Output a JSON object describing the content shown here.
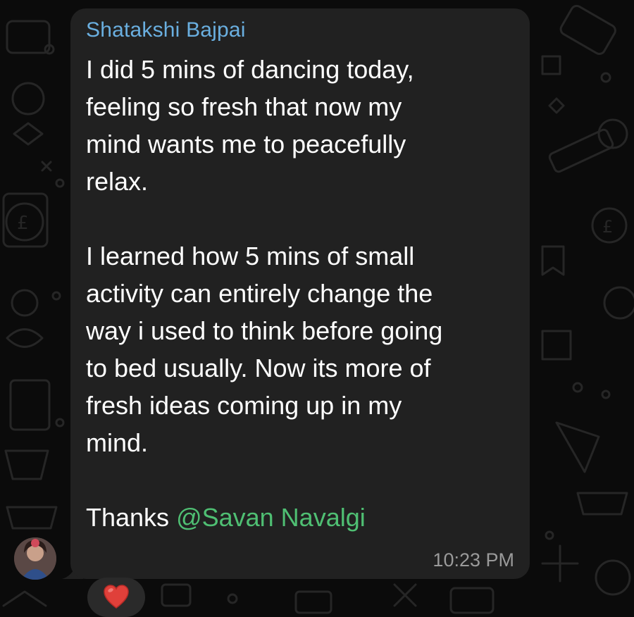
{
  "message": {
    "sender_name": "Shatakshi Bajpai",
    "text_main": "I did 5 mins of dancing today,\nfeeling so fresh that now my\nmind wants me to peacefully\nrelax.\n\nI learned how 5 mins of small\nactivity can entirely change the\nway i used to think before going\nto bed usually. Now its more of\nfresh ideas coming up in my\nmind.\n\n",
    "thanks_prefix": "Thanks ",
    "mention": "@Savan Navalgi",
    "timestamp": "10:23 PM",
    "reaction": "heart-emoji"
  },
  "colors": {
    "bubble": "#212121",
    "sender_name": "#6aafe0",
    "mention": "#4fbf73",
    "timestamp": "#9a9a9a",
    "background": "#0b0b0b"
  }
}
